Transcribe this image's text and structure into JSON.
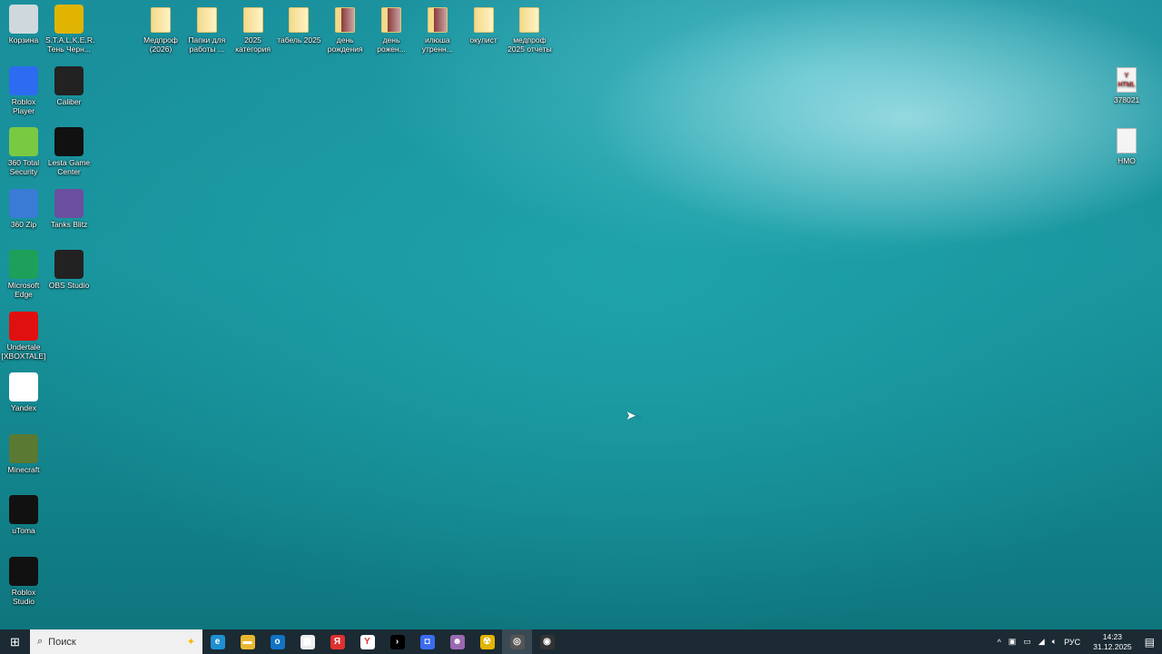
{
  "desktop_left": [
    {
      "label": "Корзина",
      "icon": "recycle-bin-icon",
      "color": "#cfd8dc",
      "col": 0
    },
    {
      "label": "S.T.A.L.K.E.R. Тень Черн...",
      "icon": "stalker-icon",
      "color": "#e0b400",
      "col": 1
    },
    {
      "label": "Roblox Player",
      "icon": "roblox-player-icon",
      "color": "#2d6cf0",
      "col": 0
    },
    {
      "label": "Caliber",
      "icon": "caliber-icon",
      "color": "#222222",
      "col": 1
    },
    {
      "label": "360 Total Security",
      "icon": "360-security-icon",
      "color": "#7ac943",
      "col": 0
    },
    {
      "label": "Lesta Game Center",
      "icon": "lesta-icon",
      "color": "#111111",
      "col": 1
    },
    {
      "label": "360 Zip",
      "icon": "360-zip-icon",
      "color": "#3a7bd5",
      "col": 0
    },
    {
      "label": "Tanks Blitz",
      "icon": "tanks-blitz-icon",
      "color": "#6a4fa0",
      "col": 1
    },
    {
      "label": "Microsoft Edge",
      "icon": "edge-icon",
      "color": "#1fa05a",
      "col": 0
    },
    {
      "label": "OBS Studio",
      "icon": "obs-icon",
      "color": "#222222",
      "col": 1
    },
    {
      "label": "Undertale [XBOXTALE]",
      "icon": "heart-icon",
      "color": "#e01010",
      "col": 0
    },
    {
      "label": "Yandex",
      "icon": "yandex-browser-icon",
      "color": "#ffffff",
      "col": 0
    },
    {
      "label": "Minecraft",
      "icon": "minecraft-icon",
      "color": "#5a7a34",
      "col": 0
    },
    {
      "label": "uToma",
      "icon": "utoma-icon",
      "color": "#111111",
      "col": 0
    },
    {
      "label": "Roblox Studio",
      "icon": "roblox-studio-icon",
      "color": "#111111",
      "col": 0
    }
  ],
  "desktop_top": [
    {
      "label": "Медпроф (2026)",
      "photo": false
    },
    {
      "label": "Папки для работы ...",
      "photo": false
    },
    {
      "label": "2025 категория",
      "photo": false
    },
    {
      "label": "табель 2025",
      "photo": false
    },
    {
      "label": "день рождения",
      "photo": true
    },
    {
      "label": "день рожен...",
      "photo": true
    },
    {
      "label": "илюша утренн...",
      "photo": true
    },
    {
      "label": "окулист",
      "photo": false
    },
    {
      "label": "медпроф 2025 отчеты",
      "photo": false
    }
  ],
  "desktop_right": [
    {
      "label": "378021",
      "icon": "html-file-icon"
    },
    {
      "label": "НМО",
      "icon": "text-file-icon"
    }
  ],
  "taskbar": {
    "search_placeholder": "Поиск",
    "apps": [
      {
        "icon": "edge-icon",
        "glyph": "e",
        "color": "#1e90d0"
      },
      {
        "icon": "file-explorer-icon",
        "glyph": "▬",
        "color": "#e8b830"
      },
      {
        "icon": "outlook-icon",
        "glyph": "o",
        "color": "#1273c4"
      },
      {
        "icon": "store-icon",
        "glyph": "▦",
        "color": "#eeeeee"
      },
      {
        "icon": "yandex-icon",
        "glyph": "Я",
        "color": "#e03030"
      },
      {
        "icon": "yandex-browser-icon",
        "glyph": "Y",
        "color": "#ffffff"
      },
      {
        "icon": "lesta-icon",
        "glyph": "›",
        "color": "#000000"
      },
      {
        "icon": "roblox-icon",
        "glyph": "◘",
        "color": "#3a6cf0"
      },
      {
        "icon": "game-icon",
        "glyph": "☻",
        "color": "#9a6ab0"
      },
      {
        "icon": "stalker-icon",
        "glyph": "☢",
        "color": "#e0b400"
      },
      {
        "icon": "caliber-icon",
        "glyph": "◎",
        "color": "#555555"
      },
      {
        "icon": "obs-recording-icon",
        "glyph": "◉",
        "color": "#333333"
      }
    ],
    "language": "РУС",
    "time": "14:23",
    "date": "31.12.2025"
  }
}
